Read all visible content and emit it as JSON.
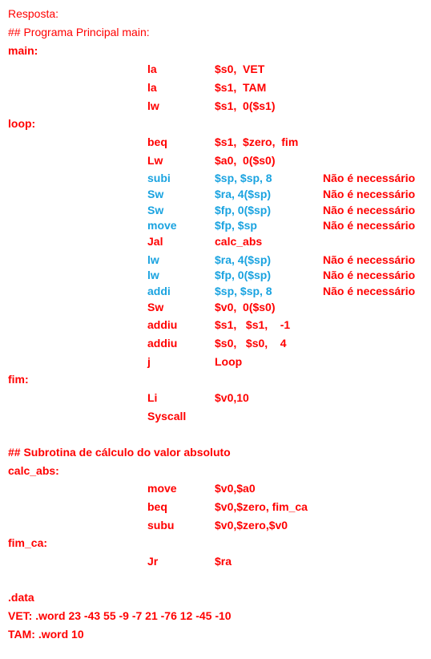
{
  "intro": {
    "answer_label": "Resposta:",
    "main_comment": "## Programa Principal main:"
  },
  "colors": {
    "text": "#ff0000",
    "highlight": "#1aa3e0"
  },
  "program": {
    "labels": {
      "main": "main:",
      "loop": "loop:",
      "fim": "fim:",
      "calc_abs": "calc_abs:",
      "fim_ca": "fim_ca:"
    },
    "main_block": [
      {
        "op": "la",
        "args": "$s0,  VET",
        "note": ""
      },
      {
        "op": "la",
        "args": "$s1,  TAM",
        "note": ""
      },
      {
        "op": "lw",
        "args": "$s1,  0($s1)",
        "note": ""
      }
    ],
    "loop_block": [
      {
        "op": "beq",
        "args": "$s1,  $zero,  fim",
        "note": ""
      },
      {
        "op": "Lw",
        "args": "$a0,  0($s0)",
        "note": ""
      },
      {
        "op": "subi",
        "args": "$sp, $sp, 8",
        "note": "Não é necessário"
      },
      {
        "op": "Sw",
        "args": "$ra, 4($sp)",
        "note": "Não é necessário"
      },
      {
        "op": "Sw",
        "args": "$fp, 0($sp)",
        "note": "Não é necessário"
      },
      {
        "op": "move",
        "args": "$fp, $sp",
        "note": "Não é necessário"
      },
      {
        "op": "Jal",
        "args": "calc_abs",
        "note": ""
      },
      {
        "op": "lw",
        "args": "$ra, 4($sp)",
        "note": "Não é necessário"
      },
      {
        "op": "lw",
        "args": "$fp, 0($sp)",
        "note": "Não é necessário"
      },
      {
        "op": "addi",
        "args": "$sp, $sp, 8",
        "note": "Não é necessário"
      },
      {
        "op": "Sw",
        "args": "$v0,  0($s0)",
        "note": ""
      },
      {
        "op": "addiu",
        "args": "$s1,   $s1,    -1",
        "note": ""
      },
      {
        "op": "addiu",
        "args": "$s0,   $s0,    4",
        "note": ""
      },
      {
        "op": "j",
        "args": "Loop",
        "note": ""
      }
    ],
    "fim_block": [
      {
        "op": "Li",
        "args": "$v0,10",
        "note": ""
      },
      {
        "op": "Syscall",
        "args": "",
        "note": ""
      }
    ],
    "sub_comment": "## Subrotina de cálculo do valor absoluto",
    "calc_block": [
      {
        "op": "move",
        "args": "$v0,$a0",
        "note": ""
      },
      {
        "op": "beq",
        "args": "$v0,$zero, fim_ca",
        "note": ""
      },
      {
        "op": "subu",
        "args": "$v0,$zero,$v0",
        "note": ""
      }
    ],
    "fim_ca_block": [
      {
        "op": "Jr",
        "args": "$ra",
        "note": ""
      }
    ]
  },
  "data_section": {
    "directive": ".data",
    "vet": "VET: .word 23 -43 55 -9 -7 21 -76 12 -45 -10",
    "tam": "TAM: .word 10"
  }
}
